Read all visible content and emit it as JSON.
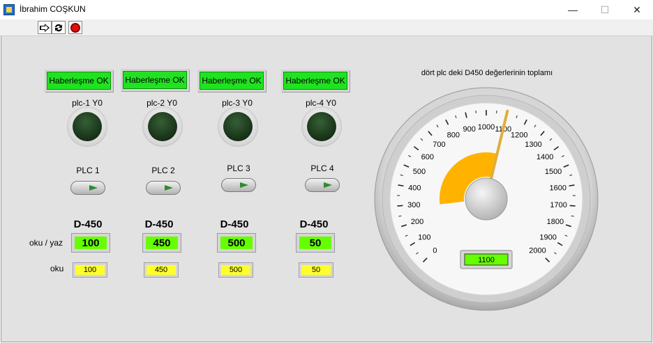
{
  "window": {
    "title": "İbrahim COŞKUN",
    "minimize_glyph": "—",
    "maximize_glyph": "☐",
    "close_glyph": "✕"
  },
  "toolbar": {
    "run_icon": "run-arrow-icon",
    "run_continuous_icon": "run-continuous-icon",
    "abort_icon": "abort-stop-icon"
  },
  "colors": {
    "panel": "#e2e2e2",
    "comm_ok": "#21e221",
    "control_fill": "#66ff00",
    "indicator_fill": "#fefe2a",
    "gauge_needle": "#e0ad3c",
    "gauge_arc": "#ffb300"
  },
  "plcs": [
    {
      "comm_label": "Haberleşme OK",
      "led_label": "plc-1 Y0",
      "switch_label": "PLC 1",
      "d_label": "D-450",
      "control_value": "100",
      "indicator_value": "100"
    },
    {
      "comm_label": "Haberleşme OK",
      "led_label": "plc-2 Y0",
      "switch_label": "PLC 2",
      "d_label": "D-450",
      "control_value": "450",
      "indicator_value": "450"
    },
    {
      "comm_label": "Haberleşme OK",
      "led_label": "plc-3 Y0",
      "switch_label": "PLC 3",
      "d_label": "D-450",
      "control_value": "500",
      "indicator_value": "500"
    },
    {
      "comm_label": "Haberleşme OK",
      "led_label": "plc-4 Y0",
      "switch_label": "PLC 4",
      "d_label": "D-450",
      "control_value": "50",
      "indicator_value": "50"
    }
  ],
  "row_labels": {
    "read_write": "oku / yaz",
    "read": "oku"
  },
  "gauge": {
    "title": "dört plc deki D450 değerlerinin toplamı",
    "min": 0,
    "max": 2000,
    "value": 1100,
    "digital_display": "1100",
    "ticks": [
      "0",
      "100",
      "200",
      "300",
      "400",
      "500",
      "600",
      "700",
      "800",
      "900",
      "1000",
      "1100",
      "1200",
      "1300",
      "1400",
      "1500",
      "1600",
      "1700",
      "1800",
      "1900",
      "2000"
    ]
  }
}
